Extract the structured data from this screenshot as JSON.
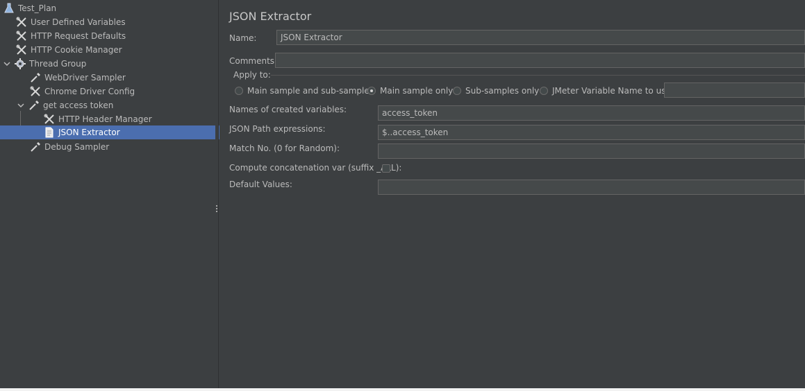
{
  "tree": {
    "items": [
      {
        "label": "Test_Plan",
        "icon": "flask-icon"
      },
      {
        "label": "User Defined Variables",
        "icon": "wrench-scissors-icon"
      },
      {
        "label": "HTTP Request Defaults",
        "icon": "wrench-scissors-icon"
      },
      {
        "label": "HTTP Cookie Manager",
        "icon": "wrench-scissors-icon"
      },
      {
        "label": "Thread Group",
        "icon": "gear-icon"
      },
      {
        "label": "WebDriver Sampler",
        "icon": "pipette-icon"
      },
      {
        "label": "Chrome Driver Config",
        "icon": "wrench-scissors-icon"
      },
      {
        "label": "get access token",
        "icon": "pipette-icon"
      },
      {
        "label": "HTTP Header Manager",
        "icon": "wrench-scissors-icon"
      },
      {
        "label": "JSON Extractor",
        "icon": "document-icon"
      },
      {
        "label": "Debug Sampler",
        "icon": "pipette-icon"
      }
    ],
    "selected": "JSON Extractor"
  },
  "panel": {
    "title": "JSON Extractor",
    "name_label": "Name:",
    "name_value": "JSON Extractor",
    "comments_label": "Comments:",
    "comments_value": "",
    "apply_to": {
      "label": "Apply to:",
      "options": [
        {
          "label": "Main sample and sub-samples",
          "checked": false
        },
        {
          "label": "Main sample only",
          "checked": true
        },
        {
          "label": "Sub-samples only",
          "checked": false
        },
        {
          "label": "JMeter Variable Name to use",
          "checked": false
        }
      ],
      "variable_value": ""
    },
    "names_label": "Names of created variables:",
    "names_value": "access_token",
    "jsonpath_label": "JSON Path expressions:",
    "jsonpath_value": "$..access_token",
    "match_label": "Match No. (0 for Random):",
    "match_value": "",
    "concat_label": "Compute concatenation var (suffix _ALL):",
    "concat_checked": false,
    "default_label": "Default Values:",
    "default_value": ""
  },
  "colors": {
    "background": "#3c3f41",
    "selection": "#4b6eaf",
    "field_background": "#45494a",
    "text": "#bbbbbb"
  }
}
